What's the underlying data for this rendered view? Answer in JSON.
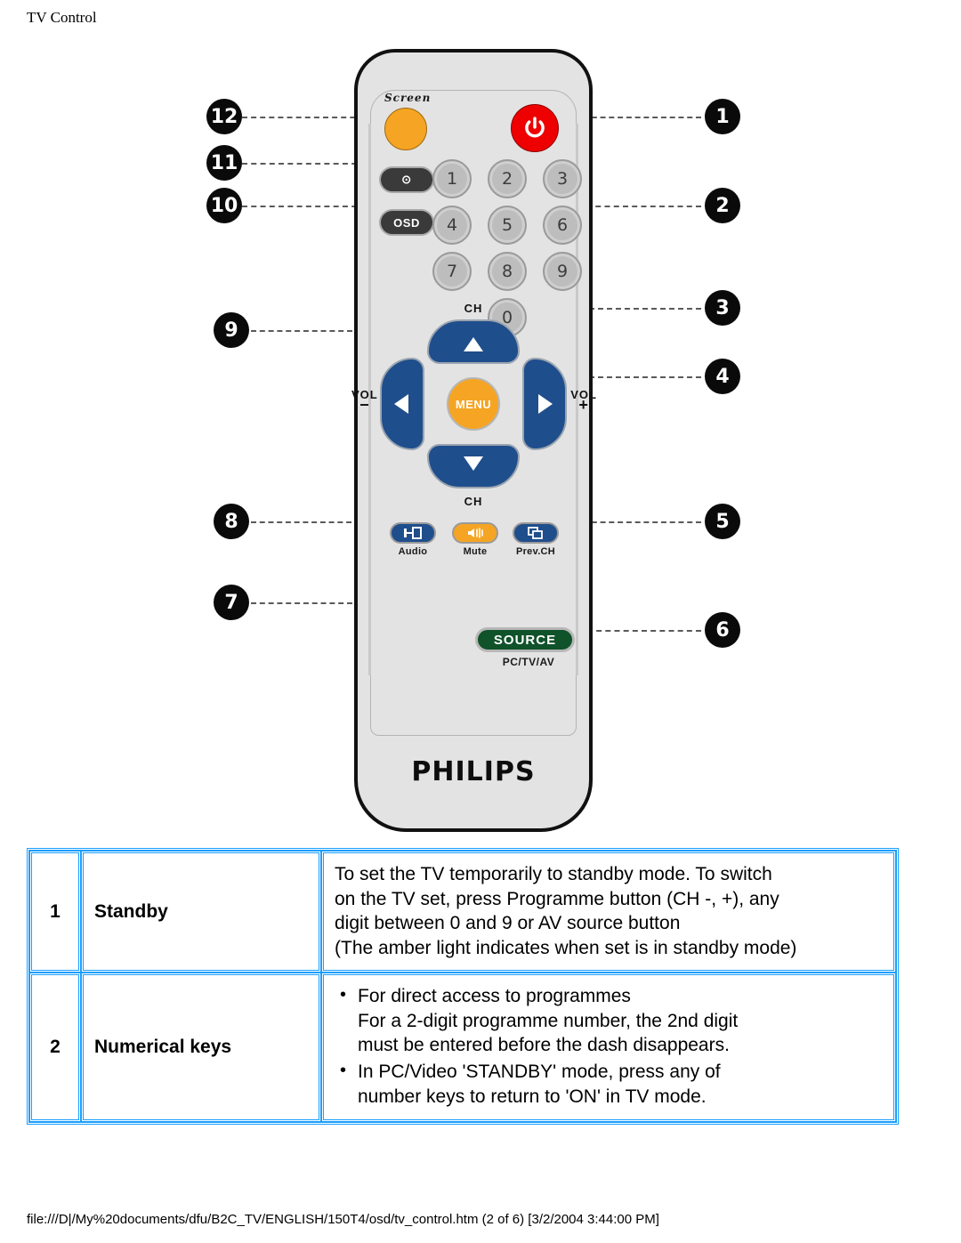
{
  "header": {
    "title": "TV Control"
  },
  "colors": {
    "table_border": "#1a9fff",
    "remote_body": "#e3e3e3",
    "accent_orange": "#f5a523",
    "power_red": "#ee0000",
    "nav_blue": "#1f4e8c",
    "source_green": "#10522a"
  },
  "remote": {
    "brand": "PHILIPS",
    "screen_label": "Screen",
    "side_buttons": [
      {
        "name": "clock-button",
        "label": "⊙"
      },
      {
        "name": "osd-button",
        "label": "OSD"
      }
    ],
    "keypad": [
      "1",
      "2",
      "3",
      "4",
      "5",
      "6",
      "7",
      "8",
      "9",
      "0"
    ],
    "nav": {
      "ch_up_label": "CH",
      "ch_down_label": "CH",
      "vol_left_label": "VOL",
      "vol_left_sign": "−",
      "vol_right_label": "VOL",
      "vol_right_sign": "+",
      "menu_label": "MENU"
    },
    "function_buttons": [
      {
        "name": "audio-button",
        "label": "Audio",
        "glyph": "↔"
      },
      {
        "name": "mute-button",
        "label": "Mute",
        "glyph": "🔇"
      },
      {
        "name": "prev-ch-button",
        "label": "Prev.CH",
        "glyph": "⧉"
      }
    ],
    "source": {
      "button_label": "SOURCE",
      "caption": "PC/TV/AV"
    }
  },
  "callouts": [
    {
      "id": "1",
      "side": "right"
    },
    {
      "id": "2",
      "side": "right"
    },
    {
      "id": "3",
      "side": "right"
    },
    {
      "id": "4",
      "side": "right"
    },
    {
      "id": "5",
      "side": "right"
    },
    {
      "id": "6",
      "side": "right"
    },
    {
      "id": "7",
      "side": "left"
    },
    {
      "id": "8",
      "side": "left"
    },
    {
      "id": "9",
      "side": "left"
    },
    {
      "id": "10",
      "side": "left"
    },
    {
      "id": "11",
      "side": "left"
    },
    {
      "id": "12",
      "side": "left"
    }
  ],
  "table": {
    "rows": [
      {
        "num": "1",
        "name": "Standby",
        "desc_lines": [
          "To set the TV temporarily to standby mode. To switch",
          "on the TV set, press Programme button (CH -, +), any",
          "digit between 0 and 9 or AV source button",
          "(The amber light indicates when set is in standby mode)"
        ]
      },
      {
        "num": "2",
        "name": "Numerical keys",
        "bullets": [
          {
            "main": "For direct access to programmes",
            "subs": [
              "For a 2-digit programme number, the 2nd digit",
              "must be entered before the dash disappears."
            ]
          },
          {
            "main": "In PC/Video 'STANDBY' mode, press any of",
            "subs": [
              "number keys to return to 'ON' in TV mode."
            ]
          }
        ]
      }
    ]
  },
  "footer": {
    "text": "file:///D|/My%20documents/dfu/B2C_TV/ENGLISH/150T4/osd/tv_control.htm (2 of 6) [3/2/2004 3:44:00 PM]"
  }
}
